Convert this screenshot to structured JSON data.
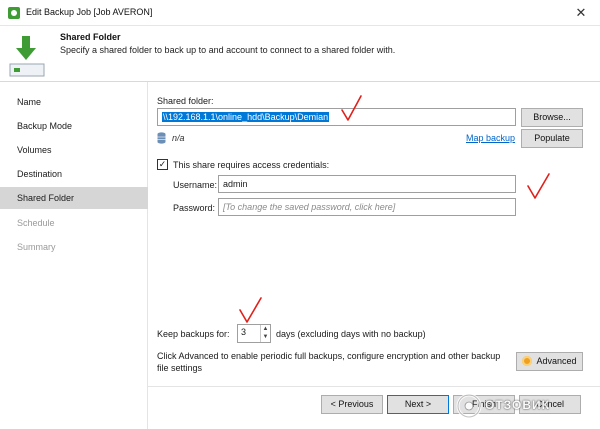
{
  "window": {
    "title": "Edit Backup Job [Job AVERON]",
    "close_glyph": "✕",
    "app_icon": "veeam-gear-icon"
  },
  "header": {
    "title": "Shared Folder",
    "description": "Specify a shared folder to back up to and account to connect to a shared folder with.",
    "icon": "download-arrow-icon"
  },
  "sidebar": {
    "items": [
      {
        "label": "Name",
        "state": "normal"
      },
      {
        "label": "Backup Mode",
        "state": "normal"
      },
      {
        "label": "Volumes",
        "state": "normal"
      },
      {
        "label": "Destination",
        "state": "normal"
      },
      {
        "label": "Shared Folder",
        "state": "active"
      },
      {
        "label": "Schedule",
        "state": "disabled"
      },
      {
        "label": "Summary",
        "state": "disabled"
      }
    ]
  },
  "main": {
    "shared_folder_label": "Shared folder:",
    "shared_folder_value": "\\\\192.168.1.1\\online_hdd\\Backup\\Demian",
    "browse_label": "Browse...",
    "na_text": "n/a",
    "map_backup_label": "Map backup",
    "populate_label": "Populate",
    "credentials_checkbox_label": "This share requires access credentials:",
    "credentials_checked": true,
    "check_glyph": "✓",
    "username_label": "Username:",
    "username_value": "admin",
    "password_label": "Password:",
    "password_placeholder": "[To change the saved password, click here]",
    "keep_backups_label": "Keep backups for:",
    "keep_backups_value": "3",
    "keep_backups_suffix": "days (excluding days with no backup)",
    "advanced_hint": "Click Advanced to enable periodic full backups, configure encryption and other backup file settings",
    "advanced_label": "Advanced",
    "spin_up_glyph": "▲",
    "spin_down_glyph": "▼"
  },
  "footer": {
    "previous_label": "< Previous",
    "next_label": "Next >",
    "finish_label": "Finish",
    "cancel_label": "Cancel"
  },
  "watermark": {
    "text": "ОТЗОВИК"
  },
  "colors": {
    "accent": "#0078d7",
    "brand_green": "#3f9c35",
    "annotation_red": "#e0201a",
    "sidebar_active": "#d6d6d6"
  }
}
